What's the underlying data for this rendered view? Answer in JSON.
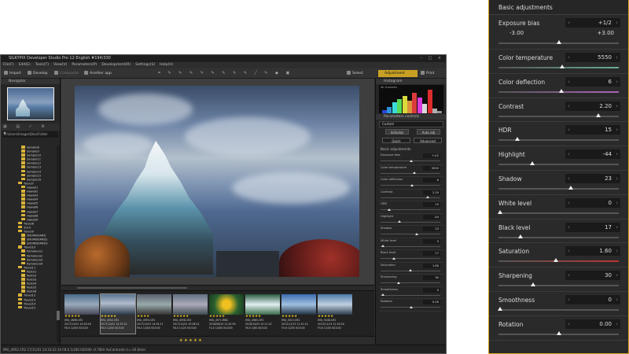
{
  "window": {
    "title": "SILKYPIX Developer Studio Pro 12 English  #194/330",
    "controls": "– □ ×"
  },
  "menu": [
    "File(F)",
    "Edit(E)",
    "Tools(T)",
    "View(V)",
    "Parameters(P)",
    "Development(R)",
    "Settings(S)",
    "Help(H)"
  ],
  "toolbar": {
    "import": "Import",
    "develop": "Develop",
    "composite": "Composite",
    "another_app": "Another app",
    "select": "Select",
    "adjustment": "Adjustment",
    "print": "Print"
  },
  "left_pane": {
    "navigator": "Navigator",
    "path": "C:\\Users\\Images\\Dev\\Folder",
    "tree": [
      "Sample8",
      "Sample9",
      "Sample10",
      "Sample11",
      "Sample12",
      "Sample13",
      "Sample14",
      "Sample15",
      "Sample16",
      "Travel7",
      "Hawaii1",
      "Hawaii2",
      "Hawaii3",
      "Hawaii4",
      "Hawaii5",
      "Hawaii6",
      "Hawaii7",
      "Hawaii8",
      "Hawaii9",
      "Travel8",
      "2019",
      "Travel9",
      "SNOWBOARD",
      "SNOWBOARD2",
      "SNOWBOARD3",
      "Travel10",
      "Kamakura1",
      "Kamakura2",
      "Kamakura3",
      "Kamakura4",
      "Travel11",
      "Kyoto1",
      "Kyoto2",
      "Kyoto3",
      "Kyoto4",
      "Kyoto5",
      "Kyoto6",
      "Travel12",
      "Travel13",
      "Travel14",
      "Travel15"
    ]
  },
  "filmstrip": [
    {
      "name": "IMG_4898.CR2",
      "line2": "2017/12/01 14:16:16",
      "line3": "F8.0 1/200 ISO100",
      "stars": "★★★★★"
    },
    {
      "name": "IMG_4952.CR2",
      "line2": "2017/12/01 14:33:22",
      "line3": "F8.0 1/200 ISO100",
      "stars": "★★★★★"
    },
    {
      "name": "IMG_4955.CR2",
      "line2": "2017/12/01 14:34:11",
      "line3": "F8.0 1/200 ISO100",
      "stars": "★★★★"
    },
    {
      "name": "IMG_4958.CR2",
      "line2": "2017/12/01 15:08:21",
      "line3": "F8.0 1/125 ISO100",
      "stars": "★★★★★"
    },
    {
      "name": "IMG_4971.RW2",
      "line2": "2018/08/10 11:24:55",
      "line3": "F4.0 1/400 ISO200",
      "stars": "★★★★★"
    },
    {
      "name": "IMG_4985.CR2",
      "line2": "2018/10/01 10:11:22",
      "line3": "F8.0 1/60 ISO100",
      "stars": "★★★★★"
    },
    {
      "name": "IMG_5013.CR2",
      "line2": "2012/11/13 11:14:14",
      "line3": "F5.6 1/250 ISO100",
      "stars": "★★★★★"
    },
    {
      "name": "IMG_5048.CR2",
      "line2": "2012/11/13 11:16:16",
      "line3": "F5.6 1/100 ISO100",
      "stars": "★★★★★"
    }
  ],
  "filmstrip_bar": "★ ★ ★ ★ ★",
  "status_bar": "IMG_4952.CR2 17/11/01 14:33:22.34 F8.0 1/200 ISO100 -0.70EV AxContrast(+)=-20.0mm",
  "right_pane": {
    "histogram": "Histogram",
    "all_channels": "All channels",
    "param_controls": "Parameters controls",
    "preset": "Custom",
    "initialize": "Initialize",
    "auto_adj": "Auto adj",
    "quick": "Quick",
    "advanced": "Advanced",
    "basic": "Basic adjustments",
    "rows": [
      {
        "name": "Exposure bias",
        "value": "+1/2",
        "knob": 50
      },
      {
        "name": "Color temperature",
        "value": "5550",
        "knob": 55
      },
      {
        "name": "Color deflection",
        "value": "6",
        "knob": 52
      },
      {
        "name": "Contrast",
        "value": "2.20",
        "knob": 78
      },
      {
        "name": "HDR",
        "value": "15",
        "knob": 12
      },
      {
        "name": "Highlight",
        "value": "-44",
        "knob": 30
      },
      {
        "name": "Shadow",
        "value": "23",
        "knob": 60
      },
      {
        "name": "White level",
        "value": "0",
        "knob": 2
      },
      {
        "name": "Black level",
        "value": "17",
        "knob": 20
      },
      {
        "name": "Saturation",
        "value": "1.60",
        "knob": 48
      },
      {
        "name": "Sharpening",
        "value": "30",
        "knob": 28
      },
      {
        "name": "Smoothness",
        "value": "0",
        "knob": 2
      },
      {
        "name": "Rotation",
        "value": "0.00",
        "knob": 50
      }
    ]
  },
  "panel": {
    "title": "Basic adjustments",
    "exposure": {
      "name": "Exposure bias",
      "value": "+1/2",
      "min": "-3.00",
      "max": "+3.00",
      "knob": 0.5
    },
    "rows": [
      {
        "name": "Color temperature",
        "value": "5550",
        "knob": 0.53,
        "accent": "#6a9"
      },
      {
        "name": "Color deflection",
        "value": "6",
        "knob": 0.52,
        "accent": "#a6b"
      },
      {
        "name": "Contrast",
        "value": "2.20",
        "knob": 0.83,
        "accent": ""
      },
      {
        "name": "HDR",
        "value": "15",
        "knob": 0.16,
        "accent": ""
      },
      {
        "name": "Highlight",
        "value": "-44",
        "knob": 0.28,
        "accent": ""
      },
      {
        "name": "Shadow",
        "value": "23",
        "knob": 0.6,
        "accent": ""
      },
      {
        "name": "White level",
        "value": "0",
        "knob": 0.01,
        "accent": ""
      },
      {
        "name": "Black level",
        "value": "17",
        "knob": 0.18,
        "accent": ""
      },
      {
        "name": "Saturation",
        "value": "1.60",
        "knob": 0.48,
        "accent": "#b33"
      },
      {
        "name": "Sharpening",
        "value": "30",
        "knob": 0.29,
        "accent": ""
      },
      {
        "name": "Smoothness",
        "value": "0",
        "knob": 0.01,
        "accent": ""
      },
      {
        "name": "Rotation",
        "value": "0.00",
        "knob": 0.5,
        "accent": ""
      }
    ]
  }
}
